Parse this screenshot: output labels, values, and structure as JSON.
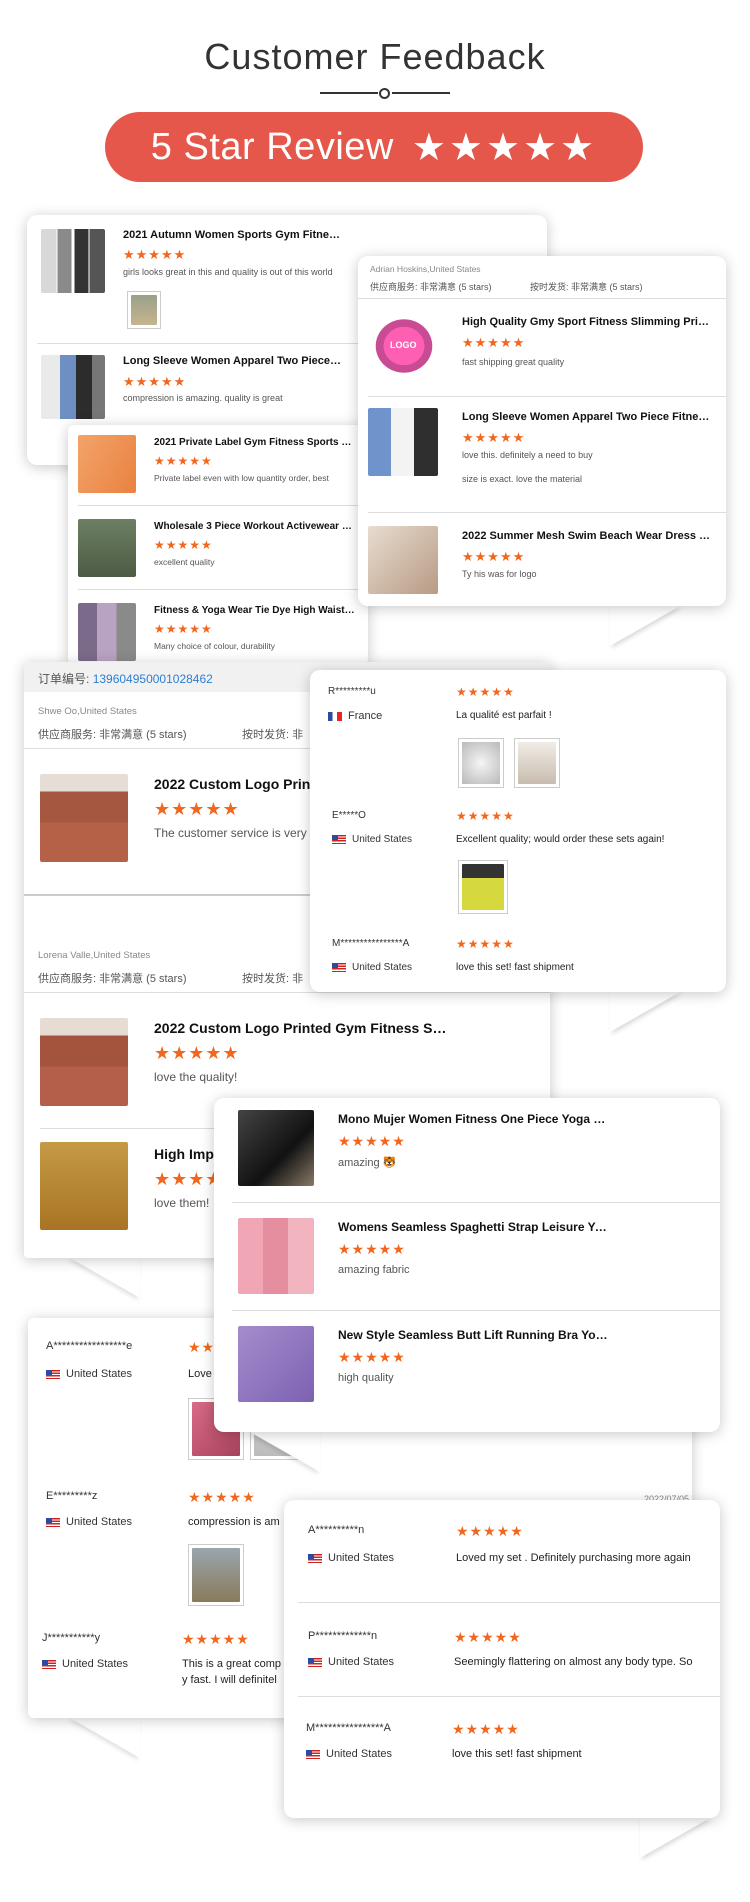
{
  "header": {
    "title": "Customer Feedback",
    "banner_text": "5 Star Review",
    "banner_stars": "★★★★★"
  },
  "stars": "★★★★★",
  "card1": {
    "items": [
      {
        "title": "2021 Autumn Women Sports Gym Fitness Lon...",
        "review": "girls looks great in this and quality is out of this world"
      },
      {
        "title": "Long Sleeve Women Apparel Two Piece Fitnes...",
        "review": "compression is amazing. quality is great"
      }
    ]
  },
  "card2": {
    "reviewer": "Adrian Hoskins,United States",
    "service": "供应商服务: 非常满意  (5 stars)",
    "ontime": "按时发货: 非常满意  (5 stars)",
    "items": [
      {
        "title": "High Quality Gmy Sport Fitness Slimming Priva...",
        "review": "fast shipping great quality",
        "logo": "LOGO"
      },
      {
        "title": "Long Sleeve Women Apparel Two Piece Fitnes...",
        "review": "love this. definitely a need to buy",
        "review2": "size is exact. love the material"
      },
      {
        "title": "2022 Summer Mesh Swim Beach Wear Dress B...",
        "review": "Ty his was for logo"
      }
    ]
  },
  "card3": {
    "items": [
      {
        "title": "2021 Private Label Gym Fitness Sports Women...",
        "review": "Private label even with low quantity order, best"
      },
      {
        "title": "Wholesale 3 Piece Workout Activewear Wome...",
        "review": "excellent quality"
      },
      {
        "title": "Fitness & Yoga Wear Tie Dye High Waisted Wor...",
        "review": "Many choice of colour, durability"
      }
    ]
  },
  "card4": {
    "order_label": "订单编号:",
    "order_no": "139604950001028462",
    "reviewer1": "Shwe Oo,United States",
    "service": "供应商服务: 非常满意  (5 stars)",
    "ontime1": "按时发货: 非",
    "item1": {
      "title": "2022 Custom Logo Print",
      "review": "The customer service is very"
    },
    "reviewer2": "Lorena Valle,United States",
    "ontime2": "按时发货: 非",
    "item2": {
      "title": "2022 Custom Logo Printed Gym Fitness Solid ...",
      "review": "love the quality!"
    },
    "item3": {
      "title": "High Impa",
      "review": "love them!"
    }
  },
  "card5": {
    "items": [
      {
        "name": "R*********u",
        "country": "France",
        "review": "La qualité est parfait !"
      },
      {
        "name": "E*****O",
        "country": "United States",
        "review": "Excellent quality; would order these sets again!"
      },
      {
        "name": "M****************A",
        "country": "United States",
        "review": "love this set! fast shipment"
      }
    ]
  },
  "card6": {
    "items": [
      {
        "title": "Mono Mujer Women Fitness One Piece Yoga J...",
        "review": "amazing 🐯"
      },
      {
        "title": "Womens Seamless Spaghetti Strap Leisure Yo...",
        "review": "amazing fabric"
      },
      {
        "title": "New Style Seamless Butt Lift Running Bra Yog...",
        "review": "high quality"
      }
    ]
  },
  "card7": {
    "items": [
      {
        "name": "A*****************e",
        "country": "United States",
        "review": "Love"
      },
      {
        "name": "E*********z",
        "country": "United States",
        "review": "compression is am",
        "date": "2022/07/05"
      },
      {
        "name": "J***********y",
        "country": "United States",
        "review": "This is a great comp",
        "review2": "y fast. I will definitel"
      }
    ]
  },
  "card8": {
    "items": [
      {
        "name": "A**********n",
        "country": "United States",
        "review": "Loved my set . Definitely purchasing more again"
      },
      {
        "name": "P*************n",
        "country": "United States",
        "review": "Seemingly flattering on almost any body type. So"
      },
      {
        "name": "M****************A",
        "country": "United States",
        "review": "love this set! fast shipment"
      }
    ]
  },
  "colors": {
    "accent": "#e4574a",
    "star": "#f2661d",
    "link": "#2d7fd1"
  }
}
